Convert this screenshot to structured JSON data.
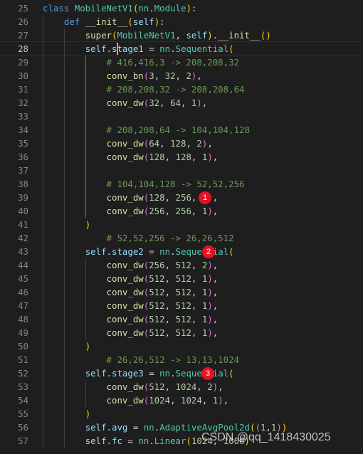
{
  "editor": {
    "theme": {
      "background": "#1e1e1e",
      "line_number": "#858585",
      "keyword": "#569cd6",
      "function": "#dcdcaa",
      "class": "#4ec9b0",
      "variable": "#9cdcfe",
      "number": "#b5cea8",
      "comment": "#6a9955",
      "marker": "#e81123"
    },
    "cursor_line": 28,
    "lines": [
      {
        "n": "25",
        "tokens": [
          [
            "kw",
            "class "
          ],
          [
            "cls",
            "MobileNetV1"
          ],
          [
            "p1",
            "("
          ],
          [
            "cls",
            "nn"
          ],
          [
            "op",
            "."
          ],
          [
            "cls",
            "Module"
          ],
          [
            "p1",
            ")"
          ],
          [
            "op",
            ":"
          ]
        ]
      },
      {
        "n": "26",
        "tokens": [
          [
            "op",
            "    "
          ],
          [
            "kw",
            "def "
          ],
          [
            "fn",
            "__init__"
          ],
          [
            "p1",
            "("
          ],
          [
            "var",
            "self"
          ],
          [
            "p1",
            ")"
          ],
          [
            "op",
            ":"
          ]
        ]
      },
      {
        "n": "27",
        "tokens": [
          [
            "op",
            "        "
          ],
          [
            "fn",
            "super"
          ],
          [
            "p1",
            "("
          ],
          [
            "cls",
            "MobileNetV1"
          ],
          [
            "op",
            ", "
          ],
          [
            "var",
            "self"
          ],
          [
            "p1",
            ")"
          ],
          [
            "op",
            "."
          ],
          [
            "fn",
            "__init__"
          ],
          [
            "p1",
            "("
          ],
          [
            "p1",
            ")"
          ]
        ]
      },
      {
        "n": "28",
        "tokens": [
          [
            "op",
            "        "
          ],
          [
            "var",
            "self"
          ],
          [
            "op",
            "."
          ],
          [
            "var",
            "stage1"
          ],
          [
            "op",
            " = "
          ],
          [
            "cls",
            "nn"
          ],
          [
            "op",
            "."
          ],
          [
            "cls",
            "Sequential"
          ],
          [
            "p1",
            "("
          ]
        ]
      },
      {
        "n": "29",
        "tokens": [
          [
            "op",
            "            "
          ],
          [
            "cm",
            "# 416,416,3 -> 208,208,32"
          ]
        ]
      },
      {
        "n": "30",
        "tokens": [
          [
            "op",
            "            "
          ],
          [
            "fn",
            "conv_bn"
          ],
          [
            "p2",
            "("
          ],
          [
            "num",
            "3"
          ],
          [
            "op",
            ", "
          ],
          [
            "num",
            "32"
          ],
          [
            "op",
            ", "
          ],
          [
            "num",
            "2"
          ],
          [
            "p2",
            ")"
          ],
          [
            "op",
            ","
          ]
        ]
      },
      {
        "n": "31",
        "tokens": [
          [
            "op",
            "            "
          ],
          [
            "cm",
            "# 208,208,32 -> 208,208,64"
          ]
        ]
      },
      {
        "n": "32",
        "tokens": [
          [
            "op",
            "            "
          ],
          [
            "fn",
            "conv_dw"
          ],
          [
            "p2",
            "("
          ],
          [
            "num",
            "32"
          ],
          [
            "op",
            ", "
          ],
          [
            "num",
            "64"
          ],
          [
            "op",
            ", "
          ],
          [
            "num",
            "1"
          ],
          [
            "p2",
            ")"
          ],
          [
            "op",
            ","
          ]
        ]
      },
      {
        "n": "33",
        "tokens": []
      },
      {
        "n": "34",
        "tokens": [
          [
            "op",
            "            "
          ],
          [
            "cm",
            "# 208,208,64 -> 104,104,128"
          ]
        ]
      },
      {
        "n": "35",
        "tokens": [
          [
            "op",
            "            "
          ],
          [
            "fn",
            "conv_dw"
          ],
          [
            "p2",
            "("
          ],
          [
            "num",
            "64"
          ],
          [
            "op",
            ", "
          ],
          [
            "num",
            "128"
          ],
          [
            "op",
            ", "
          ],
          [
            "num",
            "2"
          ],
          [
            "p2",
            ")"
          ],
          [
            "op",
            ","
          ]
        ]
      },
      {
        "n": "36",
        "tokens": [
          [
            "op",
            "            "
          ],
          [
            "fn",
            "conv_dw"
          ],
          [
            "p2",
            "("
          ],
          [
            "num",
            "128"
          ],
          [
            "op",
            ", "
          ],
          [
            "num",
            "128"
          ],
          [
            "op",
            ", "
          ],
          [
            "num",
            "1"
          ],
          [
            "p2",
            ")"
          ],
          [
            "op",
            ","
          ]
        ]
      },
      {
        "n": "37",
        "tokens": []
      },
      {
        "n": "38",
        "tokens": [
          [
            "op",
            "            "
          ],
          [
            "cm",
            "# 104,104,128 -> 52,52,256"
          ]
        ]
      },
      {
        "n": "39",
        "tokens": [
          [
            "op",
            "            "
          ],
          [
            "fn",
            "conv_dw"
          ],
          [
            "p2",
            "("
          ],
          [
            "num",
            "128"
          ],
          [
            "op",
            ", "
          ],
          [
            "num",
            "256"
          ],
          [
            "op",
            ", "
          ],
          [
            "num",
            "2"
          ],
          [
            "p2",
            ")"
          ],
          [
            "op",
            ","
          ]
        ]
      },
      {
        "n": "40",
        "tokens": [
          [
            "op",
            "            "
          ],
          [
            "fn",
            "conv_dw"
          ],
          [
            "p2",
            "("
          ],
          [
            "num",
            "256"
          ],
          [
            "op",
            ", "
          ],
          [
            "num",
            "256"
          ],
          [
            "op",
            ", "
          ],
          [
            "num",
            "1"
          ],
          [
            "p2",
            ")"
          ],
          [
            "op",
            ","
          ]
        ]
      },
      {
        "n": "41",
        "tokens": [
          [
            "op",
            "        "
          ],
          [
            "p1",
            ")"
          ]
        ]
      },
      {
        "n": "42",
        "tokens": [
          [
            "op",
            "            "
          ],
          [
            "cm",
            "# 52,52,256 -> 26,26,512"
          ]
        ]
      },
      {
        "n": "43",
        "tokens": [
          [
            "op",
            "        "
          ],
          [
            "var",
            "self"
          ],
          [
            "op",
            "."
          ],
          [
            "var",
            "stage2"
          ],
          [
            "op",
            " = "
          ],
          [
            "cls",
            "nn"
          ],
          [
            "op",
            "."
          ],
          [
            "cls",
            "Sequential"
          ],
          [
            "p1",
            "("
          ]
        ]
      },
      {
        "n": "44",
        "tokens": [
          [
            "op",
            "            "
          ],
          [
            "fn",
            "conv_dw"
          ],
          [
            "p2",
            "("
          ],
          [
            "num",
            "256"
          ],
          [
            "op",
            ", "
          ],
          [
            "num",
            "512"
          ],
          [
            "op",
            ", "
          ],
          [
            "num",
            "2"
          ],
          [
            "p2",
            ")"
          ],
          [
            "op",
            ","
          ]
        ]
      },
      {
        "n": "45",
        "tokens": [
          [
            "op",
            "            "
          ],
          [
            "fn",
            "conv_dw"
          ],
          [
            "p2",
            "("
          ],
          [
            "num",
            "512"
          ],
          [
            "op",
            ", "
          ],
          [
            "num",
            "512"
          ],
          [
            "op",
            ", "
          ],
          [
            "num",
            "1"
          ],
          [
            "p2",
            ")"
          ],
          [
            "op",
            ","
          ]
        ]
      },
      {
        "n": "46",
        "tokens": [
          [
            "op",
            "            "
          ],
          [
            "fn",
            "conv_dw"
          ],
          [
            "p2",
            "("
          ],
          [
            "num",
            "512"
          ],
          [
            "op",
            ", "
          ],
          [
            "num",
            "512"
          ],
          [
            "op",
            ", "
          ],
          [
            "num",
            "1"
          ],
          [
            "p2",
            ")"
          ],
          [
            "op",
            ","
          ]
        ]
      },
      {
        "n": "47",
        "tokens": [
          [
            "op",
            "            "
          ],
          [
            "fn",
            "conv_dw"
          ],
          [
            "p2",
            "("
          ],
          [
            "num",
            "512"
          ],
          [
            "op",
            ", "
          ],
          [
            "num",
            "512"
          ],
          [
            "op",
            ", "
          ],
          [
            "num",
            "1"
          ],
          [
            "p2",
            ")"
          ],
          [
            "op",
            ","
          ]
        ]
      },
      {
        "n": "48",
        "tokens": [
          [
            "op",
            "            "
          ],
          [
            "fn",
            "conv_dw"
          ],
          [
            "p2",
            "("
          ],
          [
            "num",
            "512"
          ],
          [
            "op",
            ", "
          ],
          [
            "num",
            "512"
          ],
          [
            "op",
            ", "
          ],
          [
            "num",
            "1"
          ],
          [
            "p2",
            ")"
          ],
          [
            "op",
            ","
          ]
        ]
      },
      {
        "n": "49",
        "tokens": [
          [
            "op",
            "            "
          ],
          [
            "fn",
            "conv_dw"
          ],
          [
            "p2",
            "("
          ],
          [
            "num",
            "512"
          ],
          [
            "op",
            ", "
          ],
          [
            "num",
            "512"
          ],
          [
            "op",
            ", "
          ],
          [
            "num",
            "1"
          ],
          [
            "p2",
            ")"
          ],
          [
            "op",
            ","
          ]
        ]
      },
      {
        "n": "50",
        "tokens": [
          [
            "op",
            "        "
          ],
          [
            "p1",
            ")"
          ]
        ]
      },
      {
        "n": "51",
        "tokens": [
          [
            "op",
            "            "
          ],
          [
            "cm",
            "# 26,26,512 -> 13,13,1024"
          ]
        ]
      },
      {
        "n": "52",
        "tokens": [
          [
            "op",
            "        "
          ],
          [
            "var",
            "self"
          ],
          [
            "op",
            "."
          ],
          [
            "var",
            "stage3"
          ],
          [
            "op",
            " = "
          ],
          [
            "cls",
            "nn"
          ],
          [
            "op",
            "."
          ],
          [
            "cls",
            "Sequential"
          ],
          [
            "p1",
            "("
          ]
        ]
      },
      {
        "n": "53",
        "tokens": [
          [
            "op",
            "            "
          ],
          [
            "fn",
            "conv_dw"
          ],
          [
            "p2",
            "("
          ],
          [
            "num",
            "512"
          ],
          [
            "op",
            ", "
          ],
          [
            "num",
            "1024"
          ],
          [
            "op",
            ", "
          ],
          [
            "num",
            "2"
          ],
          [
            "p2",
            ")"
          ],
          [
            "op",
            ","
          ]
        ]
      },
      {
        "n": "54",
        "tokens": [
          [
            "op",
            "            "
          ],
          [
            "fn",
            "conv_dw"
          ],
          [
            "p2",
            "("
          ],
          [
            "num",
            "1024"
          ],
          [
            "op",
            ", "
          ],
          [
            "num",
            "1024"
          ],
          [
            "op",
            ", "
          ],
          [
            "num",
            "1"
          ],
          [
            "p2",
            ")"
          ],
          [
            "op",
            ","
          ]
        ]
      },
      {
        "n": "55",
        "tokens": [
          [
            "op",
            "        "
          ],
          [
            "p1",
            ")"
          ]
        ]
      },
      {
        "n": "56",
        "tokens": [
          [
            "op",
            "        "
          ],
          [
            "var",
            "self"
          ],
          [
            "op",
            "."
          ],
          [
            "var",
            "avg"
          ],
          [
            "op",
            " = "
          ],
          [
            "cls",
            "nn"
          ],
          [
            "op",
            "."
          ],
          [
            "cls",
            "AdaptiveAvgPool2d"
          ],
          [
            "p1",
            "("
          ],
          [
            "p2",
            "("
          ],
          [
            "num",
            "1"
          ],
          [
            "op",
            ","
          ],
          [
            "num",
            "1"
          ],
          [
            "p2",
            ")"
          ],
          [
            "p1",
            ")"
          ]
        ]
      },
      {
        "n": "57",
        "tokens": [
          [
            "op",
            "        "
          ],
          [
            "var",
            "self"
          ],
          [
            "op",
            "."
          ],
          [
            "var",
            "fc"
          ],
          [
            "op",
            " = "
          ],
          [
            "cls",
            "nn"
          ],
          [
            "op",
            "."
          ],
          [
            "cls",
            "Linear"
          ],
          [
            "p1",
            "("
          ],
          [
            "num",
            "1024"
          ],
          [
            "op",
            ", "
          ],
          [
            "num",
            "1000"
          ],
          [
            "p1",
            ")"
          ]
        ]
      }
    ]
  },
  "annotations": [
    {
      "label": "1",
      "line": "39"
    },
    {
      "label": "2",
      "line": "43"
    },
    {
      "label": "3",
      "line": "52"
    }
  ],
  "watermark": "CSDN @qq_1418430025"
}
